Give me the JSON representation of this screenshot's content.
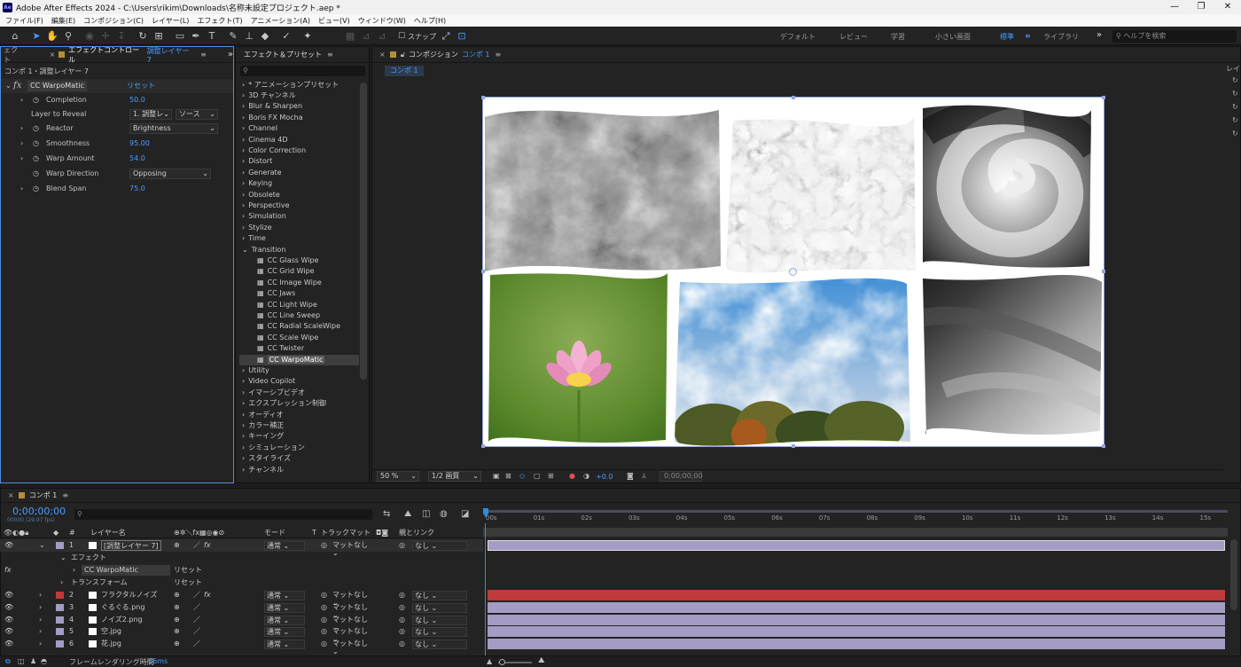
{
  "window": {
    "title": "Adobe After Effects 2024 - C:\\Users\\rikim\\Downloads\\名称未設定プロジェクト.aep *",
    "logo": "Ae",
    "min": "—",
    "max": "❐",
    "close": "✕"
  },
  "menu": [
    "ファイル(F)",
    "編集(E)",
    "コンポジション(C)",
    "レイヤー(L)",
    "エフェクト(T)",
    "アニメーション(A)",
    "ビュー(V)",
    "ウィンドウ(W)",
    "ヘルプ(H)"
  ],
  "toolbar": {
    "snap_label": "スナップ",
    "workspaces": [
      "デフォルト",
      "レビュー",
      "学習",
      "小さい画面",
      "標準",
      "ライブラリ"
    ],
    "active_workspace": "標準",
    "search_placeholder": "ヘルプを検索"
  },
  "effect_controls": {
    "left_tab": "ェクト",
    "tab": "エフェクトコントロール",
    "tab_layer": "調整レイヤー 7",
    "breadcrumb": "コンポ 1・調整レイヤー 7",
    "effect": "CC WarpoMatic",
    "reset": "リセット",
    "props": [
      {
        "name": "Completion",
        "value": "50.0"
      },
      {
        "name": "Layer to Reveal",
        "value": "1. 調整レ",
        "value2": "ソース"
      },
      {
        "name": "Reactor",
        "value": "Brightness"
      },
      {
        "name": "Smoothness",
        "value": "95.00"
      },
      {
        "name": "Warp Amount",
        "value": "54.0"
      },
      {
        "name": "Warp Direction",
        "value": "Opposing"
      },
      {
        "name": "Blend Span",
        "value": "75.0"
      }
    ]
  },
  "effects_presets": {
    "title": "エフェクト＆プリセット",
    "search_placeholder": "",
    "items": [
      "* アニメーションプリセット",
      "3D チャンネル",
      "Blur & Sharpen",
      "Boris FX Mocha",
      "Channel",
      "Cinema 4D",
      "Color Correction",
      "Distort",
      "Generate",
      "Keying",
      "Obsolete",
      "Perspective",
      "Simulation",
      "Stylize",
      "Time",
      "Transition",
      "CC Glass Wipe",
      "CC Grid Wipe",
      "CC Image Wipe",
      "CC Jaws",
      "CC Light Wipe",
      "CC Line Sweep",
      "CC Radial ScaleWipe",
      "CC Scale Wipe",
      "CC Twister",
      "CC WarpoMatic",
      "Utility",
      "Video Copilot",
      "イマーシブビデオ",
      "エクスプレッション制御",
      "オーディオ",
      "カラー補正",
      "キーイング",
      "シミュレーション",
      "スタイライズ",
      "チャンネル"
    ],
    "selected": "CC WarpoMatic"
  },
  "composition": {
    "tab_label": "コンポジション",
    "comp_name": "コンポ 1",
    "sub_tab": "コンポ 1",
    "zoom": "50 %",
    "resolution": "1/2 画質",
    "exposure": "+0.0",
    "timecode": "0;00;00;00"
  },
  "timeline": {
    "tab": "コンポ 1",
    "timecode": "0;00;00;00",
    "fps": "00000 (29.97 fps)",
    "columns": {
      "layer_name": "レイヤー名",
      "mode": "モード",
      "track_matte": "トラックマット",
      "parent": "親とリンク"
    },
    "ruler": [
      "00s",
      "01s",
      "02s",
      "03s",
      "04s",
      "05s",
      "06s",
      "07s",
      "08s",
      "09s",
      "10s",
      "11s",
      "12s",
      "13s",
      "14s",
      "15s"
    ],
    "layers": [
      {
        "num": "1",
        "name": "[調整レイヤー 7]",
        "mode": "通常",
        "matte": "マットなし",
        "parent": "なし",
        "color": "#a49cc4"
      },
      {
        "num": "2",
        "name": "フラクタルノイズ",
        "mode": "通常",
        "matte": "マットなし",
        "parent": "なし",
        "color": "#c0393b"
      },
      {
        "num": "3",
        "name": "ぐるぐる.png",
        "mode": "通常",
        "matte": "マットなし",
        "parent": "なし",
        "color": "#a49cc4"
      },
      {
        "num": "4",
        "name": "ノイズ2.png",
        "mode": "通常",
        "matte": "マットなし",
        "parent": "なし",
        "color": "#a49cc4"
      },
      {
        "num": "5",
        "name": "空.jpg",
        "mode": "通常",
        "matte": "マットなし",
        "parent": "なし",
        "color": "#a49cc4"
      },
      {
        "num": "6",
        "name": "花.jpg",
        "mode": "通常",
        "matte": "マットなし",
        "parent": "なし",
        "color": "#a49cc4"
      }
    ],
    "sub": {
      "effects": "エフェクト",
      "effect_name": "CC WarpoMatic",
      "reset": "リセット",
      "transform": "トランスフォーム",
      "transform_reset": "リセット"
    },
    "footer_label": "フレームレンダリング時間",
    "footer_value": "66ms"
  }
}
